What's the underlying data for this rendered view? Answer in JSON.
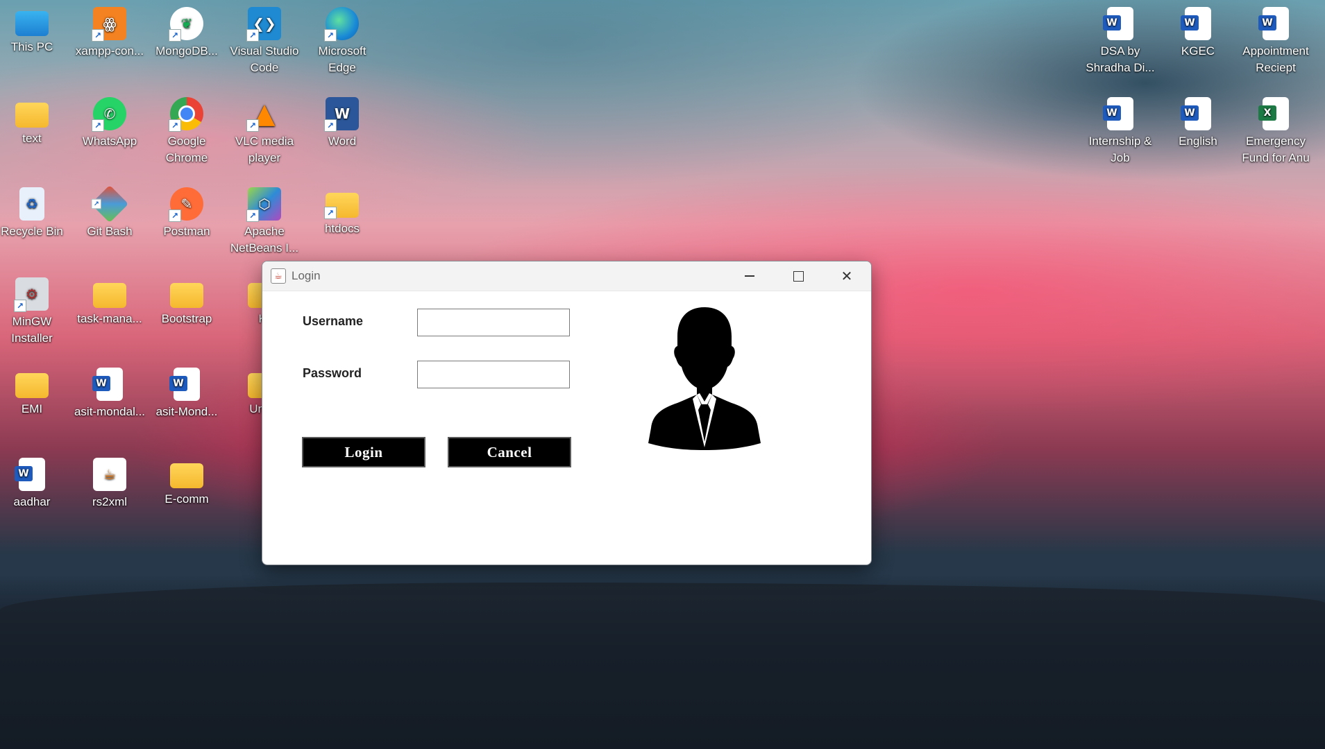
{
  "desktop": {
    "icons_left": [
      {
        "label": "This PC",
        "icon": "monitor-icon"
      },
      {
        "label": "xampp-con...",
        "icon": "xampp-icon"
      },
      {
        "label": "MongoDB...",
        "icon": "mongodb-icon"
      },
      {
        "label": "Visual Studio Code",
        "icon": "vscode-icon"
      },
      {
        "label": "Microsoft Edge",
        "icon": "edge-icon"
      },
      {
        "label": "text",
        "icon": "folder-icon"
      },
      {
        "label": "WhatsApp",
        "icon": "whatsapp-icon"
      },
      {
        "label": "Google Chrome",
        "icon": "chrome-icon"
      },
      {
        "label": "VLC media player",
        "icon": "vlc-icon"
      },
      {
        "label": "Word",
        "icon": "word-icon"
      },
      {
        "label": "Recycle Bin",
        "icon": "recycle-bin-icon"
      },
      {
        "label": "Git Bash",
        "icon": "git-icon"
      },
      {
        "label": "Postman",
        "icon": "postman-icon"
      },
      {
        "label": "Apache NetBeans I...",
        "icon": "netbeans-icon"
      },
      {
        "label": "htdocs",
        "icon": "folder-icon"
      },
      {
        "label": "MinGW Installer",
        "icon": "mingw-icon"
      },
      {
        "label": "task-mana...",
        "icon": "folder-icon"
      },
      {
        "label": "Bootstrap",
        "icon": "folder-icon"
      },
      {
        "label": "K(",
        "icon": "folder-icon"
      },
      {
        "label": "EMI",
        "icon": "folder-icon"
      },
      {
        "label": "asit-mondal...",
        "icon": "word-doc-icon"
      },
      {
        "label": "asit-Mond...",
        "icon": "word-doc-icon"
      },
      {
        "label": "Unive",
        "icon": "folder-icon"
      },
      {
        "label": "aadhar",
        "icon": "word-doc-icon"
      },
      {
        "label": "rs2xml",
        "icon": "java-icon"
      },
      {
        "label": "E-comm",
        "icon": "folder-icon"
      }
    ],
    "icons_right": [
      {
        "label": "DSA by Shradha Di...",
        "icon": "word-doc-icon"
      },
      {
        "label": "KGEC",
        "icon": "word-doc-icon"
      },
      {
        "label": "Appointment Reciept",
        "icon": "word-doc-icon"
      },
      {
        "label": "Internship & Job",
        "icon": "word-doc-icon"
      },
      {
        "label": "English",
        "icon": "word-doc-icon"
      },
      {
        "label": "Emergency Fund for Anu",
        "icon": "excel-doc-icon"
      }
    ]
  },
  "window": {
    "title": "Login",
    "username_label": "Username",
    "password_label": "Password",
    "username_value": "",
    "password_value": "",
    "login_button": "Login",
    "cancel_button": "Cancel",
    "avatar_icon": "user-avatar-icon"
  },
  "colors": {
    "button_bg": "#000000",
    "button_text": "#ffffff",
    "window_bg": "#ffffff",
    "titlebar_bg": "#f3f3f3"
  }
}
